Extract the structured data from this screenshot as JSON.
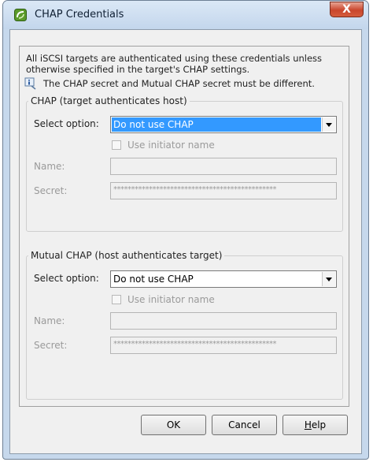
{
  "window": {
    "title": "CHAP Credentials",
    "close_glyph": "X",
    "icon": "vsphere-app-icon"
  },
  "intro": {
    "text": "All iSCSI targets are authenticated using these credentials unless otherwise specified in the target's CHAP settings.",
    "note": "The CHAP secret and Mutual CHAP secret must be different.",
    "note_icon": "info-note-icon"
  },
  "chap": {
    "legend": "CHAP (target authenticates host)",
    "select_label": "Select option:",
    "select_value": "Do not use CHAP",
    "use_initiator_label": "Use initiator name",
    "use_initiator_checked": false,
    "name_label": "Name:",
    "name_value": "",
    "secret_label": "Secret:",
    "secret_value": "**********************************************"
  },
  "mutual_chap": {
    "legend": "Mutual CHAP (host authenticates target)",
    "select_label": "Select option:",
    "select_value": "Do not use CHAP",
    "use_initiator_label": "Use initiator name",
    "use_initiator_checked": false,
    "name_label": "Name:",
    "name_value": "",
    "secret_label": "Secret:",
    "secret_value": "**********************************************"
  },
  "buttons": {
    "ok": "OK",
    "cancel": "Cancel",
    "help_first": "H",
    "help_rest": "elp"
  },
  "colors": {
    "selection": "#3399ff",
    "frame": "#c6d8ec",
    "close_button": "#c9462c"
  }
}
